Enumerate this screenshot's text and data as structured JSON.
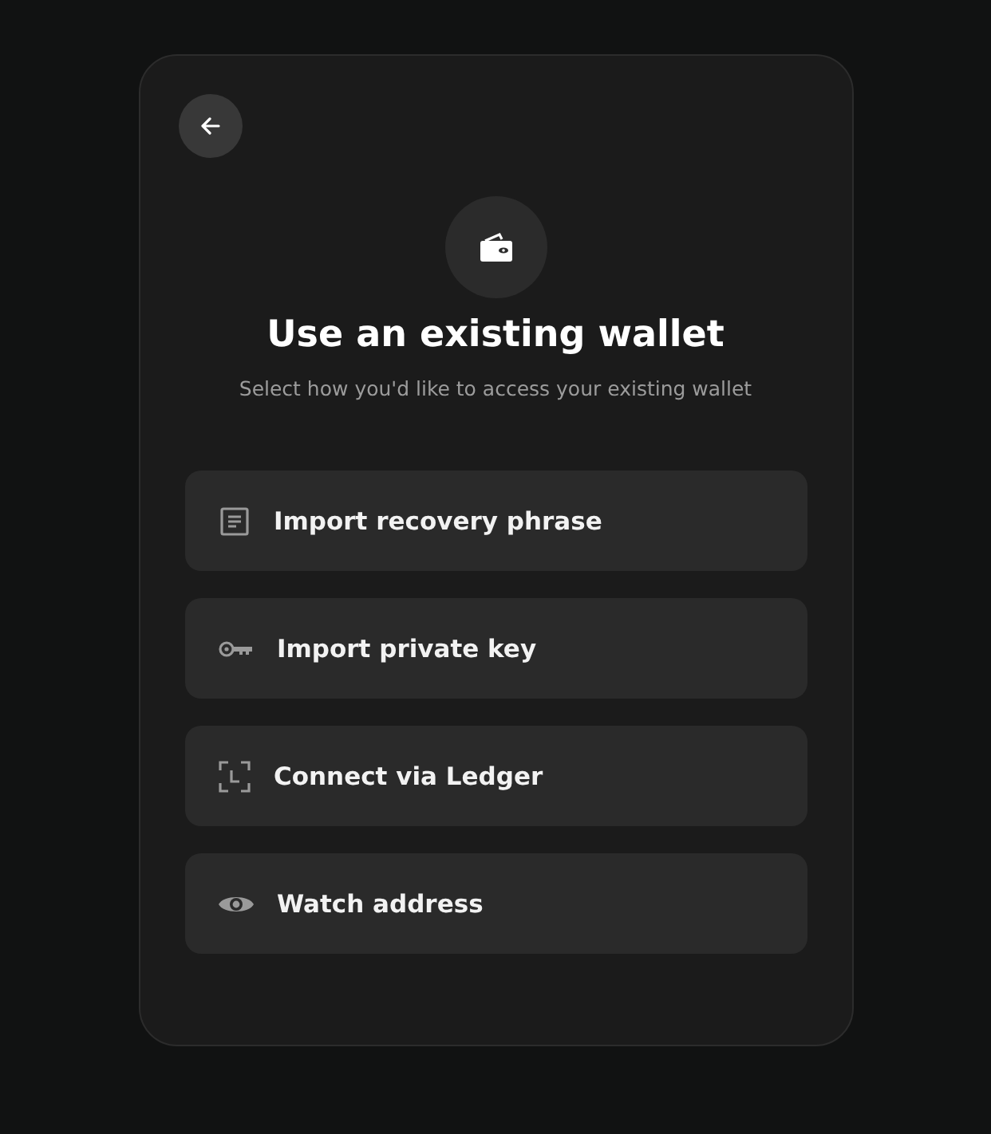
{
  "title": "Use an existing wallet",
  "subtitle": "Select how you'd like to access your existing wallet",
  "options": [
    {
      "kind": "phrase",
      "label": "Import recovery phrase"
    },
    {
      "kind": "key",
      "label": "Import private key"
    },
    {
      "kind": "ledger",
      "label": "Connect via Ledger"
    },
    {
      "kind": "watch",
      "label": "Watch address"
    }
  ]
}
